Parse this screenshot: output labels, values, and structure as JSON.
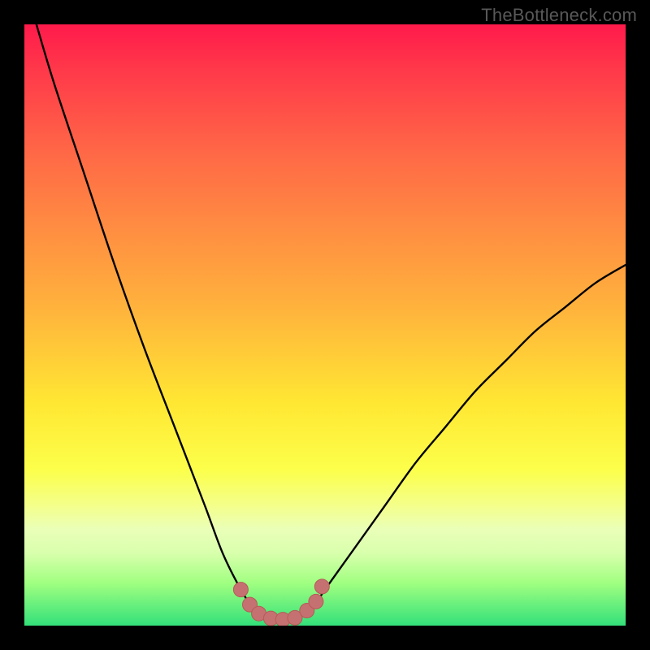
{
  "attribution": "TheBottleneck.com",
  "colors": {
    "background": "#000000",
    "curve": "#000000",
    "marker_fill": "#c67171",
    "marker_stroke": "#b65a58",
    "gradient_top": "#ff1a4b",
    "gradient_bottom": "#33e07a"
  },
  "chart_data": {
    "type": "line",
    "title": "",
    "xlabel": "",
    "ylabel": "",
    "xlim": [
      0,
      100
    ],
    "ylim": [
      0,
      100
    ],
    "series": [
      {
        "name": "bottleneck-curve",
        "x": [
          2,
          5,
          10,
          15,
          20,
          25,
          30,
          33,
          36,
          38,
          40,
          42,
          44,
          46,
          48,
          50,
          55,
          60,
          65,
          70,
          75,
          80,
          85,
          90,
          95,
          100
        ],
        "values": [
          100,
          90,
          75,
          60,
          46,
          33,
          20,
          12,
          6,
          3,
          1.5,
          1,
          1,
          1.5,
          3,
          6,
          13,
          20,
          27,
          33,
          39,
          44,
          49,
          53,
          57,
          60
        ]
      }
    ],
    "markers": {
      "name": "optimal-range",
      "x": [
        36,
        37.5,
        39,
        41,
        43,
        45,
        47,
        48.5,
        49.5
      ],
      "values": [
        6,
        3.5,
        2,
        1.2,
        1,
        1.3,
        2.5,
        4,
        6.5
      ]
    }
  }
}
